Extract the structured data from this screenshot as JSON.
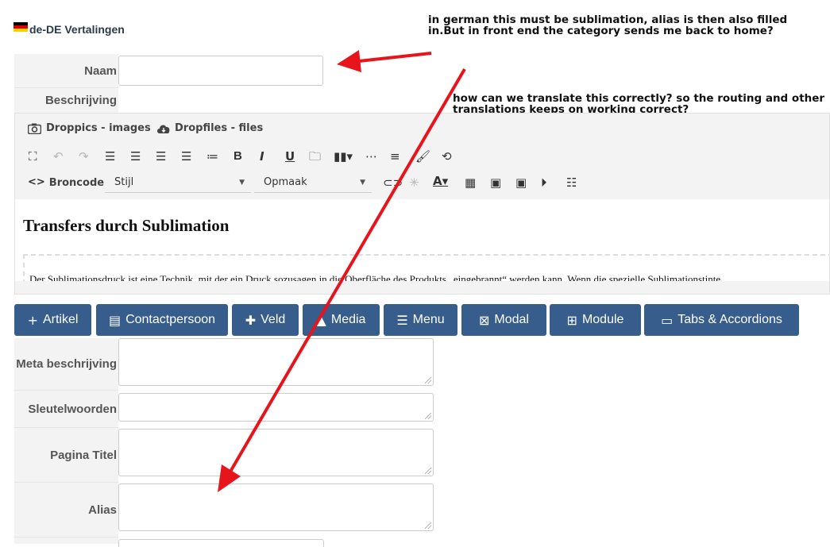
{
  "header": {
    "title": "de-DE Vertalingen"
  },
  "annotations": {
    "note_top": "in german this must be sublimation, alias is then also filled in.But in front end the category sends me back to home?",
    "note_middle": "how can we translate this correctly? so the routing and other translations keeps on working correct?"
  },
  "fields": {
    "naam_label": "Naam",
    "naam_value": "",
    "beschrijving_label": "Beschrijving",
    "meta_label": "Meta beschrijving",
    "sleutel_label": "Sleutelwoorden",
    "pagina_label": "Pagina Titel",
    "alias_label": "Alias"
  },
  "editor": {
    "droppics_label": "Droppics - images",
    "dropfiles_label": "Dropfiles - files",
    "broncode_label": "Broncode",
    "style_select": "Stijl",
    "format_select": "Opmaak",
    "heading": "Transfers durch Sublimation",
    "paragraph": "Der Sublimationsdruck ist eine Technik, mit der ein Druck sozusagen in die Oberfläche des Produkts „eingebrannt“ werden kann. Wenn die spezielle Sublimationstinte"
  },
  "buttons": {
    "artikel": "Artikel",
    "contactpersoon": "Contactpersoon",
    "veld": "Veld",
    "media": "Media",
    "menu": "Menu",
    "modal": "Modal",
    "module": "Module",
    "tabs": "Tabs & Accordions"
  },
  "colors": {
    "button_bg": "#365d8c",
    "annotation_arrow": "#e8141b",
    "label_bg": "#f3f3f3"
  },
  "icons": [
    "camera-icon",
    "cloud-download-icon",
    "fullscreen-icon",
    "undo-icon",
    "redo-icon",
    "align-left-icon",
    "align-right-icon",
    "align-center-icon",
    "align-justify-icon",
    "bullet-list-icon",
    "bold-icon",
    "italic-icon",
    "underline-icon",
    "folder-star-icon",
    "barcode-icon",
    "page-break-icon",
    "paragraph-icon",
    "format-painter-icon",
    "find-replace-icon",
    "link-icon",
    "unlink-icon",
    "text-color-icon",
    "table-icon",
    "media-embed-icon",
    "template-icon",
    "video-icon",
    "checklist-icon"
  ]
}
